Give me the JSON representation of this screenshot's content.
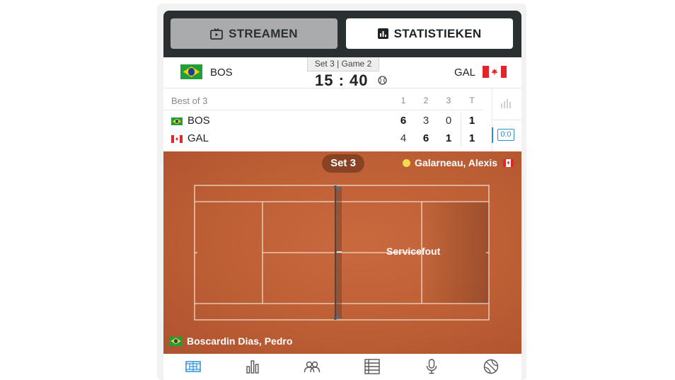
{
  "tabs": {
    "stream_label": "STREAMEN",
    "stats_label": "STATISTIEKEN",
    "stream_icon": "tv-icon",
    "stats_icon": "bar-chart-icon"
  },
  "scoreboard": {
    "home": {
      "abbr": "BOS",
      "flag": "brazil-flag"
    },
    "away": {
      "abbr": "GAL",
      "flag": "canada-flag"
    },
    "set_game": "Set 3 | Game 2",
    "point_score": "15 : 40",
    "server_icon": "tennis-ball-icon"
  },
  "sets_table": {
    "best_of": "Best of 3",
    "headers": [
      "1",
      "2",
      "3",
      "T"
    ],
    "rows": [
      {
        "name": "BOS",
        "scores": [
          "6",
          "3",
          "0"
        ],
        "total": "1"
      },
      {
        "name": "GAL",
        "scores": [
          "4",
          "6",
          "1"
        ],
        "total": "1"
      }
    ],
    "badge": "0:0"
  },
  "court": {
    "set_label": "Set 3",
    "server_name": "Galarneau, Alexis",
    "event": "Servicefout",
    "receiver_name": "Boscardin Dias, Pedro",
    "colors": {
      "clay": "#c2633a",
      "ball": "#f3dc4a",
      "accent": "#2b8fd6"
    }
  },
  "bottom_nav": {
    "items": [
      "court-icon",
      "bar-chart-icon",
      "lineups-icon",
      "table-icon",
      "microphone-icon",
      "tennis-ball-icon"
    ]
  }
}
